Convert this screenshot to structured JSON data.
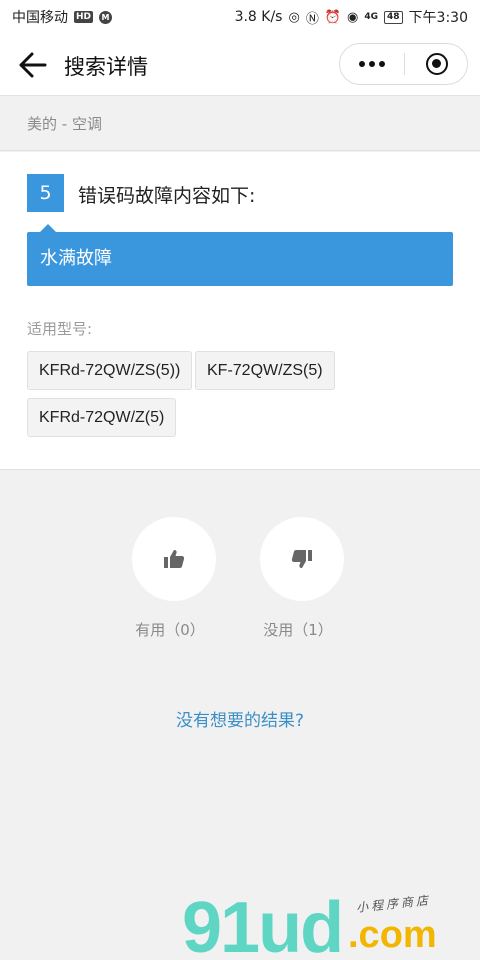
{
  "status_bar": {
    "carrier": "中国移动",
    "hd_badge": "HD",
    "net_speed": "3.8 K/s",
    "signal_label": "4G",
    "battery": "48",
    "time": "下午3:30"
  },
  "nav": {
    "title": "搜索详情"
  },
  "breadcrumb": {
    "text": "美的 - 空调"
  },
  "fault": {
    "code": "5",
    "heading": "错误码故障内容如下:",
    "description": "水满故障",
    "models_label": "适用型号:",
    "models": [
      "KFRd-72QW/ZS(5))",
      "KF-72QW/ZS(5)",
      "KFRd-72QW/Z(5)"
    ]
  },
  "feedback": {
    "useful_label": "有用（0）",
    "useless_label": "没用（1）",
    "useful_count": 0,
    "useless_count": 1
  },
  "no_result_link": "没有想要的结果?",
  "watermark": {
    "logo": "91ud",
    "suffix": ".com",
    "subtitle": "小程序商店"
  },
  "colors": {
    "accent": "#3a96dd",
    "link": "#3a8fc7",
    "background": "#f1f1f1",
    "watermark_teal": "#5fd6c4",
    "watermark_yellow": "#f2b500"
  }
}
